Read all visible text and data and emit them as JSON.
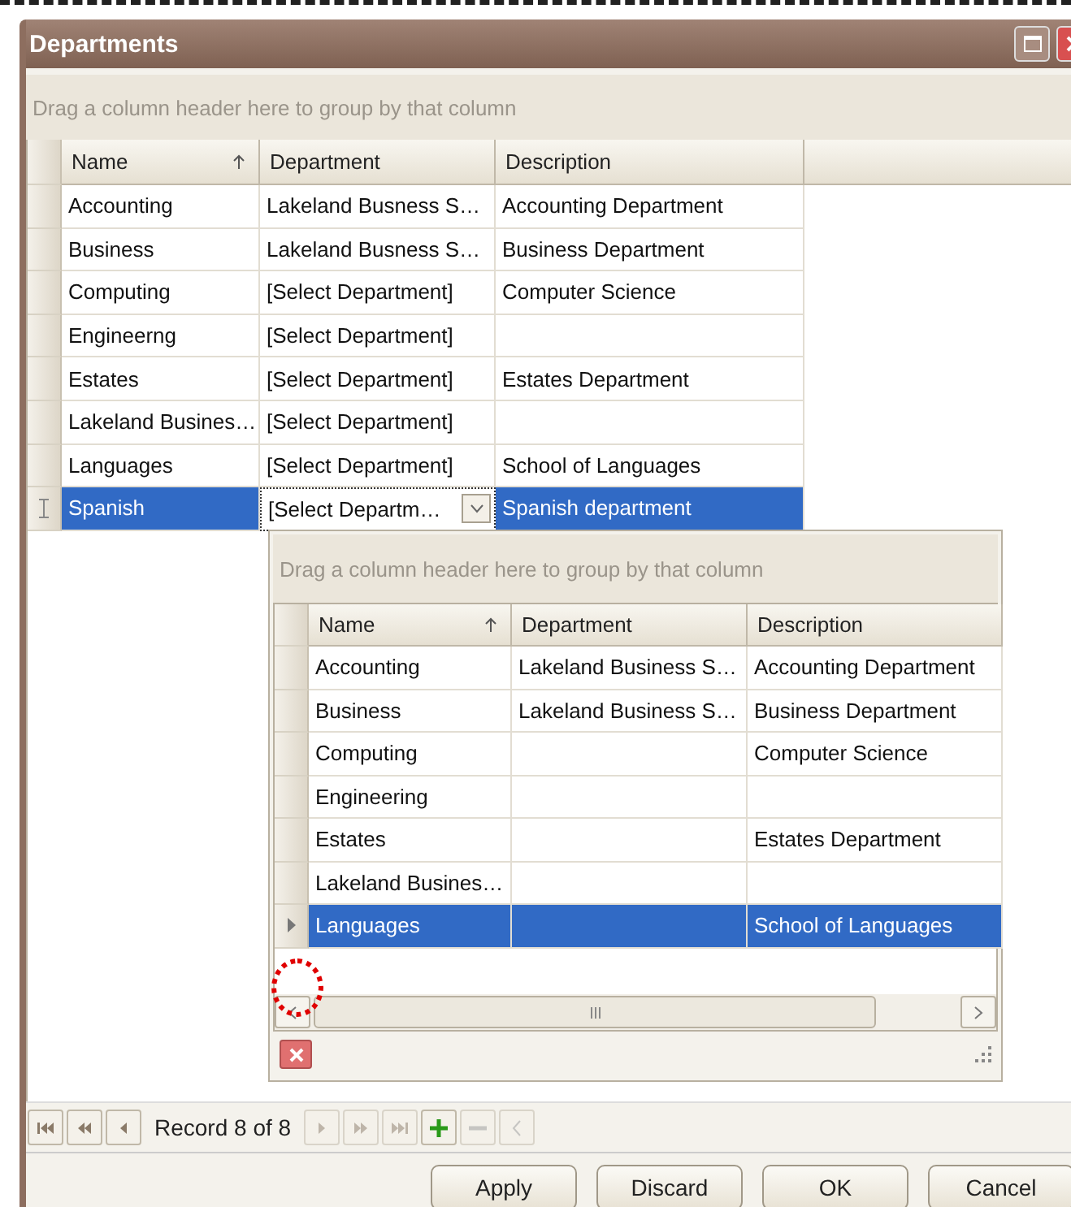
{
  "window": {
    "title": "Departments"
  },
  "grid": {
    "group_hint": "Drag a column header here to group by that column",
    "columns": [
      {
        "label": "Name",
        "sorted": true
      },
      {
        "label": "Department",
        "sorted": false
      },
      {
        "label": "Description",
        "sorted": false
      }
    ],
    "rows": [
      {
        "editing": false,
        "selected": false,
        "cells": [
          {
            "kind": "text",
            "text": "Accounting"
          },
          {
            "kind": "text",
            "text": "Lakeland Busness S…"
          },
          {
            "kind": "text",
            "text": "Accounting Department"
          }
        ]
      },
      {
        "editing": false,
        "selected": false,
        "cells": [
          {
            "kind": "text",
            "text": "Business"
          },
          {
            "kind": "text",
            "text": "Lakeland Busness S…"
          },
          {
            "kind": "text",
            "text": "Business Department"
          }
        ]
      },
      {
        "editing": false,
        "selected": false,
        "cells": [
          {
            "kind": "text",
            "text": "Computing"
          },
          {
            "kind": "text",
            "text": "[Select Department]"
          },
          {
            "kind": "text",
            "text": "Computer Science"
          }
        ]
      },
      {
        "editing": false,
        "selected": false,
        "cells": [
          {
            "kind": "text",
            "text": "Engineerng"
          },
          {
            "kind": "text",
            "text": "[Select Department]"
          },
          {
            "kind": "text",
            "text": ""
          }
        ]
      },
      {
        "editing": false,
        "selected": false,
        "cells": [
          {
            "kind": "text",
            "text": "Estates"
          },
          {
            "kind": "text",
            "text": "[Select Department]"
          },
          {
            "kind": "text",
            "text": "Estates Department"
          }
        ]
      },
      {
        "editing": false,
        "selected": false,
        "cells": [
          {
            "kind": "text",
            "text": "Lakeland Busines…"
          },
          {
            "kind": "text",
            "text": "[Select Department]"
          },
          {
            "kind": "text",
            "text": ""
          }
        ]
      },
      {
        "editing": false,
        "selected": false,
        "cells": [
          {
            "kind": "text",
            "text": "Languages"
          },
          {
            "kind": "text",
            "text": "[Select Department]"
          },
          {
            "kind": "text",
            "text": "School of Languages"
          }
        ]
      },
      {
        "editing": true,
        "selected": true,
        "cells": [
          {
            "kind": "text",
            "text": "Spanish"
          },
          {
            "kind": "combo",
            "text": "[Select Departm…"
          },
          {
            "kind": "text",
            "text": "Spanish department"
          }
        ]
      }
    ]
  },
  "dropdown": {
    "group_hint": "Drag a column header here to group by that column",
    "columns": [
      {
        "label": "Name",
        "sorted": true
      },
      {
        "label": "Department",
        "sorted": false
      },
      {
        "label": "Description",
        "sorted": false
      }
    ],
    "rows": [
      {
        "current": false,
        "selected": false,
        "cells": [
          {
            "kind": "text",
            "text": "Accounting"
          },
          {
            "kind": "text",
            "text": "Lakeland Business S…"
          },
          {
            "kind": "text",
            "text": "Accounting Department"
          }
        ]
      },
      {
        "current": false,
        "selected": false,
        "cells": [
          {
            "kind": "text",
            "text": "Business"
          },
          {
            "kind": "text",
            "text": "Lakeland Business S…"
          },
          {
            "kind": "text",
            "text": "Business Department"
          }
        ]
      },
      {
        "current": false,
        "selected": false,
        "cells": [
          {
            "kind": "text",
            "text": "Computing"
          },
          {
            "kind": "text",
            "text": ""
          },
          {
            "kind": "text",
            "text": "Computer Science"
          }
        ]
      },
      {
        "current": false,
        "selected": false,
        "cells": [
          {
            "kind": "text",
            "text": "Engineering"
          },
          {
            "kind": "text",
            "text": ""
          },
          {
            "kind": "text",
            "text": ""
          }
        ]
      },
      {
        "current": false,
        "selected": false,
        "cells": [
          {
            "kind": "text",
            "text": "Estates"
          },
          {
            "kind": "text",
            "text": ""
          },
          {
            "kind": "text",
            "text": "Estates Department"
          }
        ]
      },
      {
        "current": false,
        "selected": false,
        "cells": [
          {
            "kind": "text",
            "text": "Lakeland Busines…"
          },
          {
            "kind": "text",
            "text": ""
          },
          {
            "kind": "text",
            "text": ""
          }
        ]
      },
      {
        "current": true,
        "selected": true,
        "cells": [
          {
            "kind": "text",
            "text": "Languages"
          },
          {
            "kind": "text",
            "text": ""
          },
          {
            "kind": "text",
            "text": "School of Languages"
          }
        ]
      }
    ]
  },
  "navigator": {
    "record_label": "Record 8 of 8",
    "buttons": [
      {
        "kind": "first",
        "disabled": false
      },
      {
        "kind": "prev_page",
        "disabled": false
      },
      {
        "kind": "prev",
        "disabled": false
      },
      {
        "kind": "next",
        "disabled": true
      },
      {
        "kind": "next_page",
        "disabled": true
      },
      {
        "kind": "last",
        "disabled": true
      },
      {
        "kind": "add",
        "disabled": false
      },
      {
        "kind": "remove",
        "disabled": true
      },
      {
        "kind": "scroll_left",
        "disabled": true
      }
    ]
  },
  "buttons": [
    "Apply",
    "Discard",
    "OK",
    "Cancel"
  ]
}
